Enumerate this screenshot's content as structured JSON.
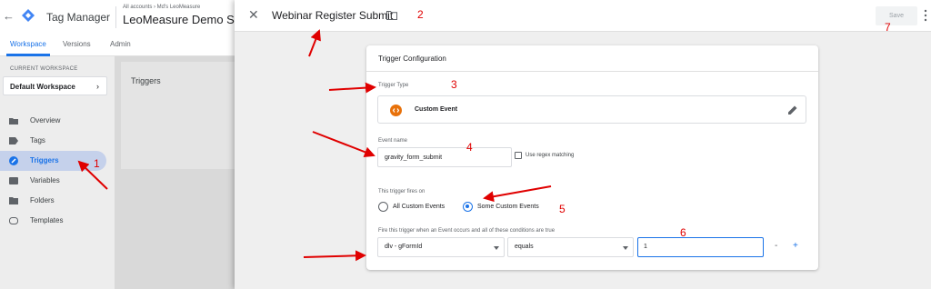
{
  "app": {
    "name": "Tag Manager",
    "accounts_crumb": "All accounts › Md's LeoMeasure",
    "container_name": "LeoMeasure Demo Site"
  },
  "nav_tabs": [
    "Workspace",
    "Versions",
    "Admin"
  ],
  "sidebar": {
    "current_workspace_label": "CURRENT WORKSPACE",
    "workspace_name": "Default Workspace",
    "items": [
      {
        "label": "Overview",
        "icon": "folder-outline-icon"
      },
      {
        "label": "Tags",
        "icon": "tag-icon"
      },
      {
        "label": "Triggers",
        "icon": "trigger-icon",
        "active": true
      },
      {
        "label": "Variables",
        "icon": "variables-icon"
      },
      {
        "label": "Folders",
        "icon": "folder-icon"
      },
      {
        "label": "Templates",
        "icon": "template-icon"
      }
    ]
  },
  "main": {
    "triggers_title": "Triggers"
  },
  "panel": {
    "title": "Webinar Register Submit",
    "save_label": "Save",
    "card_title": "Trigger Configuration",
    "trigger_type_label": "Trigger Type",
    "trigger_type_name": "Custom Event",
    "event_name_label": "Event name",
    "event_name_value": "gravity_form_submit",
    "regex_label": "Use regex matching",
    "fires_on_label": "This trigger fires on",
    "radio_all": "All Custom Events",
    "radio_some": "Some Custom Events",
    "condition_label": "Fire this trigger when an Event occurs and all of these conditions are true",
    "condition_variable": "dlv - gFormId",
    "condition_operator": "equals",
    "condition_value": "1",
    "minus_label": "-",
    "plus_label": "+"
  },
  "annotations": [
    "1",
    "2",
    "3",
    "4",
    "5",
    "6",
    "7"
  ],
  "colors": {
    "accent": "#1a73e8",
    "annotation_red": "#e00000",
    "custom_event_orange": "#e8710a",
    "gtm_blue": "#4285f4"
  }
}
